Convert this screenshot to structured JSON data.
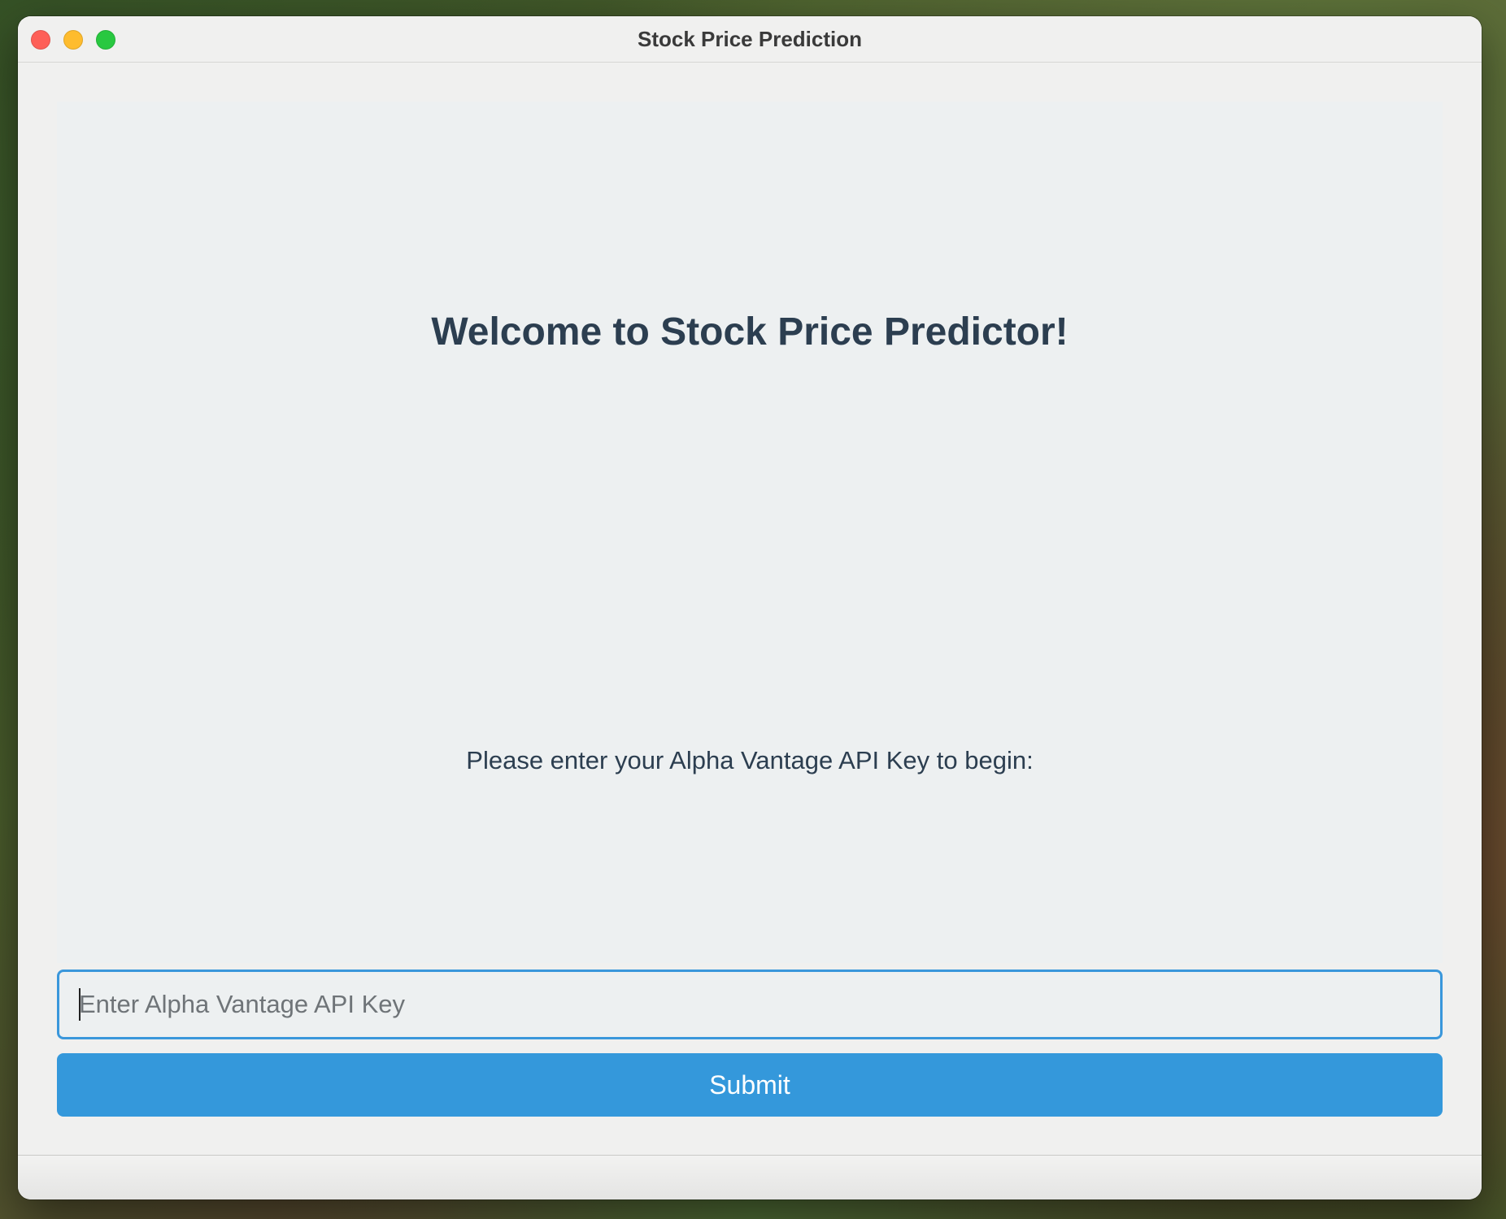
{
  "window": {
    "title": "Stock Price Prediction"
  },
  "main": {
    "welcome_heading": "Welcome to Stock Price Predictor!",
    "prompt_text": "Please enter your Alpha Vantage API Key to begin:"
  },
  "api_key_input": {
    "value": "",
    "placeholder": "Enter Alpha Vantage API Key"
  },
  "submit_button": {
    "label": "Submit"
  },
  "colors": {
    "accent": "#3498db",
    "input_focus_border": "#3a97db",
    "text": "#2c3e50",
    "panel_background": "#edf0f1",
    "window_background": "#f0f0ef"
  }
}
